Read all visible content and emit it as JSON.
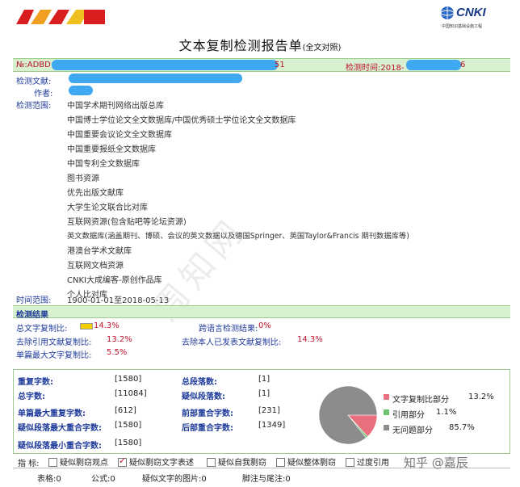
{
  "header": {
    "title": "文本复制检测报告单",
    "title_suffix": "(全文对照)",
    "cnki_logo": "CNKI",
    "cnki_sub": "中国知识基础设施工程"
  },
  "meta": {
    "no_label": "№:ADBD",
    "no_tail": "51",
    "time_label": "检测时间:2018-",
    "time_tail": "6",
    "doc_label": "检测文献:",
    "author_label": "作者:",
    "range_label": "检测范围:",
    "time_range_label": "时间范围:",
    "time_range_value": "1900-01-01至2018-05-13"
  },
  "databases": [
    "中国学术期刊网络出版总库",
    "中国博士学位论文全文数据库/中国优秀硕士学位论文全文数据库",
    "中国重要会议论文全文数据库",
    "中国重要报纸全文数据库",
    "中国专利全文数据库",
    "图书资源",
    "优先出版文献库",
    "大学生论文联合比对库",
    "互联网资源(包含贴吧等论坛资源)",
    "英文数据库(涵盖期刊、博硕、会议的英文数据以及德国Springer、英国Taylor&Francis 期刊数据库等)",
    "港澳台学术文献库",
    "互联网文档资源",
    "CNKI大成编客-原创作品库",
    "个人比对库"
  ],
  "results": {
    "section_title": "检测结果",
    "total_copy_label": "总文字复制比:",
    "total_copy_value": "14.3%",
    "cross_lang_label": "跨语言检测结果:",
    "cross_lang_value": "0%",
    "excl_quote_label": "去除引用文献复制比:",
    "excl_quote_value": "13.2%",
    "excl_self_label": "去除本人已发表文献复制比:",
    "excl_self_value": "14.3%",
    "max_single_label": "单篇最大文字复制比:",
    "max_single_value": "5.5%"
  },
  "stats": {
    "repeat_chars_label": "重复字数:",
    "repeat_chars_value": "[1580]",
    "total_paras_label": "总段落数:",
    "total_paras_value": "[1]",
    "total_chars_label": "总字数:",
    "total_chars_value": "[11084]",
    "suspect_paras_label": "疑似段落数:",
    "suspect_paras_value": "[1]",
    "max_repeat_label": "单篇最大重复字数:",
    "max_repeat_value": "[612]",
    "front_overlap_label": "前部重合字数:",
    "front_overlap_value": "[231]",
    "max_overlap_label": "疑似段落最大重合字数:",
    "max_overlap_value": "[1580]",
    "back_overlap_label": "后部重合字数:",
    "back_overlap_value": "[1349]",
    "min_overlap_label": "疑似段落最小重合字数:",
    "min_overlap_value": "[1580]"
  },
  "chart_data": {
    "type": "pie",
    "slices": [
      {
        "label": "文字复制比部分",
        "value": 13.2,
        "display": "13.2%",
        "color": "#e8707e"
      },
      {
        "label": "引用部分",
        "value": 1.1,
        "display": "1.1%",
        "color": "#6cc46c"
      },
      {
        "label": "无问题部分",
        "value": 85.7,
        "display": "85.7%",
        "color": "#8c8c8c"
      }
    ],
    "legend_position": "right"
  },
  "indicators": {
    "label": "指 标:",
    "items": [
      {
        "label": "疑似剽窃观点",
        "checked": false
      },
      {
        "label": "疑似剽窃文字表述",
        "checked": true
      },
      {
        "label": "疑似自我剽窃",
        "checked": false
      },
      {
        "label": "疑似整体剽窃",
        "checked": false
      },
      {
        "label": "过度引用",
        "checked": false
      }
    ]
  },
  "footer": {
    "tables": "表格:0",
    "formulas": "公式:0",
    "images": "疑似文字的图片:0",
    "footnotes": "脚注与尾注:0"
  },
  "watermark": "知乎 @嘉辰",
  "ghost_watermark": "周知网"
}
